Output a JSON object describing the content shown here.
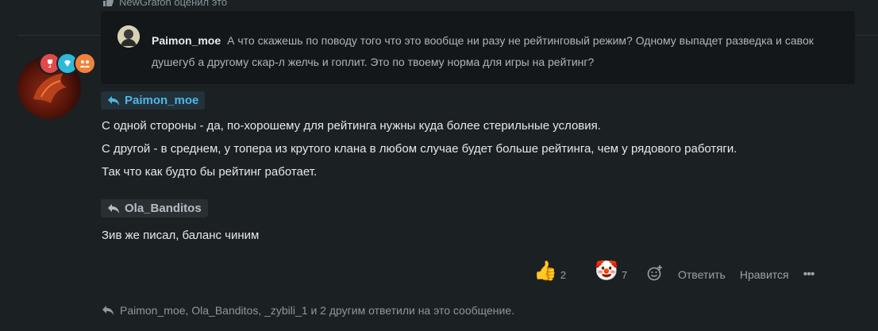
{
  "top_notice": {
    "text": "NewGrafon оценил это"
  },
  "quote": {
    "author": "Paimon_moe",
    "text": "А что скажешь по поводу того что это вообще ни разу не рейтинговый режим? Одному выпадет разведка и савок душегуб а другому скар-л желчь и гоплит. Это по твоему норма для игры на рейтинг?"
  },
  "mentions": [
    {
      "name": "Paimon_moe",
      "color": "#51b5e6"
    },
    {
      "name": "Ola_Banditos",
      "color": "#b5bcc2"
    }
  ],
  "body_lines": [
    "С одной стороны - да, по-хорошему для рейтинга нужны куда более стерильные условия.",
    "С другой - в среднем, у топера из крутого клана в любом случае будет больше рейтинга, чем у рядового работяги.",
    "Так что как будто бы рейтинг работает.",
    "Зив же писал, баланс чиним"
  ],
  "reactions": [
    {
      "icon": "thumbs-up-icon",
      "emoji": "👍",
      "count": "2"
    },
    {
      "icon": "clown-icon",
      "emoji": "🤡",
      "count": "7"
    }
  ],
  "actions": {
    "reply": "Ответить",
    "like": "Нравится",
    "more": "•••"
  },
  "replies_text": "Paimon_moe, Ola_Banditos, _zybili_1 и 2 другим ответили на это сообщение.",
  "colors": {
    "background": "#1b2023",
    "quote_bg": "#13171a",
    "accent": "#51b5e6"
  }
}
